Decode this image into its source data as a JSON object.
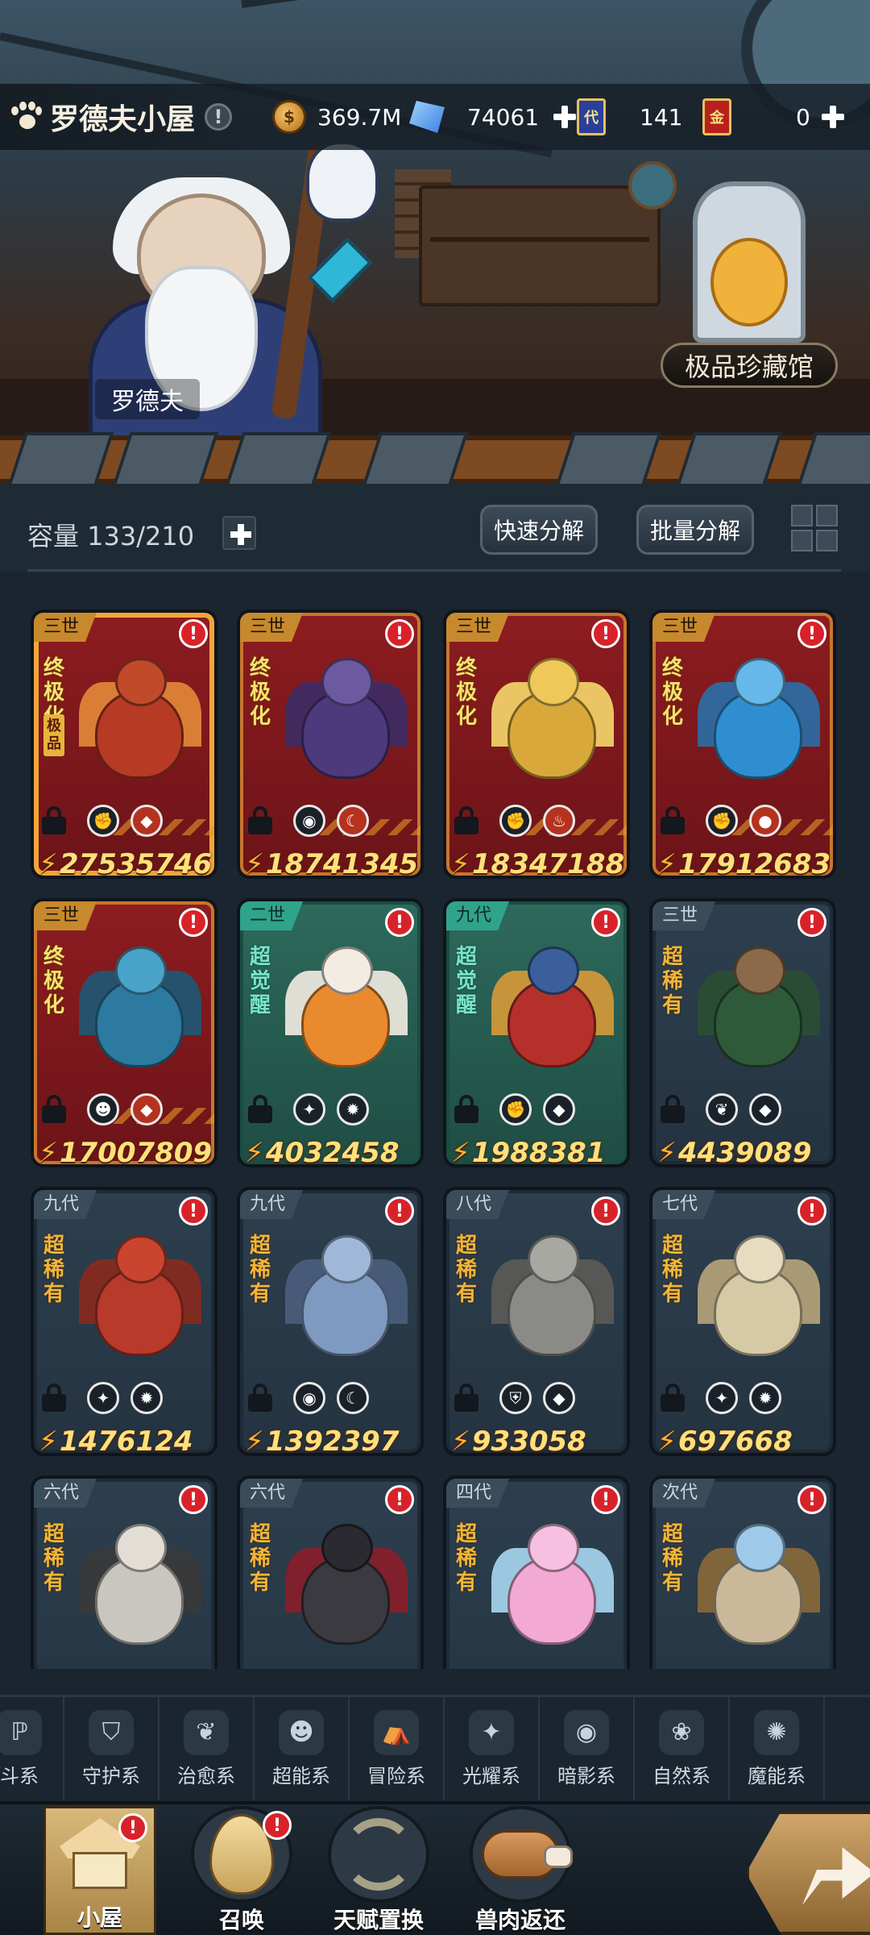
{
  "topbar": {
    "home_title": "罗德夫小屋",
    "info_icon_glyph": "!",
    "gold": "369.7M",
    "crystal": "74061",
    "ticket_glyph": "代",
    "ticket_count": "141",
    "gold_card_glyph": "金",
    "gold_card_count": "0",
    "coin_glyph": "$"
  },
  "scene": {
    "npc_name": "罗德夫",
    "collection_label": "极品珍藏馆"
  },
  "toolbar": {
    "capacity_label": "容量 133/210",
    "quick_decompose": "快速分解",
    "batch_decompose": "批量分解"
  },
  "cards": [
    {
      "gen": "三世",
      "rank": "终极化",
      "extra": "极品",
      "power": "27535746",
      "style": "red",
      "selected": true,
      "elements": [
        "gauntlet",
        "rock"
      ],
      "body_color": "#b63a24",
      "head_color": "#c14a2a",
      "wing_color": "#e38a3a"
    },
    {
      "gen": "三世",
      "rank": "终极化",
      "power": "18741345",
      "style": "red",
      "elements": [
        "eye",
        "moon"
      ],
      "body_color": "#4d3a7c",
      "head_color": "#6c5aa0",
      "wing_color": "#3b2c66"
    },
    {
      "gen": "三世",
      "rank": "终极化",
      "power": "18347188",
      "style": "red",
      "elements": [
        "gauntlet",
        "fire"
      ],
      "body_color": "#d8a93a",
      "head_color": "#f0c85a",
      "wing_color": "#f6d86b"
    },
    {
      "gen": "三世",
      "rank": "终极化",
      "power": "17912683",
      "style": "red",
      "elements": [
        "gauntlet",
        "water"
      ],
      "body_color": "#2f8ed0",
      "head_color": "#66b8ea",
      "wing_color": "#2a6fa8"
    },
    {
      "gen": "三世",
      "rank": "终极化",
      "power": "17007809",
      "style": "red",
      "elements": [
        "alien",
        "rock"
      ],
      "body_color": "#2d7aa0",
      "head_color": "#4aa3c8",
      "wing_color": "#1d5978"
    },
    {
      "gen": "二世",
      "rank": "超觉醒",
      "power": "4032458",
      "style": "green",
      "elements": [
        "star-cross",
        "sun"
      ],
      "body_color": "#e98a2e",
      "head_color": "#f3ece2",
      "wing_color": "#f3ece2"
    },
    {
      "gen": "九代",
      "rank": "超觉醒",
      "power": "1988381",
      "style": "green",
      "elements": [
        "gauntlet",
        "rock"
      ],
      "body_color": "#b5302a",
      "head_color": "#3a5f9a",
      "wing_color": "#d89a38"
    },
    {
      "gen": "三世",
      "rank": "超稀有",
      "power": "4439089",
      "style": "blue",
      "elements": [
        "leaf",
        "rock"
      ],
      "body_color": "#2f5a3a",
      "head_color": "#8a6a4a",
      "wing_color": "#2a4f33"
    },
    {
      "gen": "九代",
      "rank": "超稀有",
      "power": "1476124",
      "style": "blue",
      "elements": [
        "star-cross",
        "sun"
      ],
      "body_color": "#b73a2a",
      "head_color": "#c9452f",
      "wing_color": "#8a2a1e"
    },
    {
      "gen": "九代",
      "rank": "超稀有",
      "power": "1392397",
      "style": "blue",
      "elements": [
        "eye",
        "moon"
      ],
      "body_color": "#7e9ac0",
      "head_color": "#9fb8d8",
      "wing_color": "#4a5f7e"
    },
    {
      "gen": "八代",
      "rank": "超稀有",
      "power": "933058",
      "style": "blue",
      "elements": [
        "shield",
        "rock"
      ],
      "body_color": "#8a8a86",
      "head_color": "#a8a8a3",
      "wing_color": "#5c5c58"
    },
    {
      "gen": "七代",
      "rank": "超稀有",
      "power": "697668",
      "style": "blue",
      "elements": [
        "star-cross",
        "sun"
      ],
      "body_color": "#d6c9a5",
      "head_color": "#e6dcbf",
      "wing_color": "#b7a57a"
    },
    {
      "gen": "六代",
      "rank": "超稀有",
      "power": "",
      "style": "blue",
      "elements": [],
      "body_color": "#c9c6c0",
      "head_color": "#e2ded6",
      "wing_color": "#3a3a3a"
    },
    {
      "gen": "六代",
      "rank": "超稀有",
      "power": "",
      "style": "blue",
      "elements": [],
      "body_color": "#3a3a40",
      "head_color": "#2a2a30",
      "wing_color": "#8a1e2a"
    },
    {
      "gen": "四代",
      "rank": "超稀有",
      "power": "",
      "style": "blue",
      "elements": [],
      "body_color": "#f2a9d4",
      "head_color": "#f7c0e0",
      "wing_color": "#a7d7f2"
    },
    {
      "gen": "次代",
      "rank": "超稀有",
      "power": "",
      "style": "blue",
      "elements": [],
      "body_color": "#c9b89a",
      "head_color": "#9fc9e8",
      "wing_color": "#8a6a3a"
    }
  ],
  "element_glyphs": {
    "gauntlet": "✊",
    "rock": "◆",
    "eye": "◉",
    "moon": "☾",
    "fire": "♨",
    "water": "●",
    "alien": "☻",
    "star-cross": "✦",
    "sun": "✹",
    "leaf": "❦",
    "shield": "⛨"
  },
  "alert_glyph": "!",
  "categories": [
    {
      "label": "斗系",
      "glyph": "ℙ",
      "name": "fighting-category"
    },
    {
      "label": "守护系",
      "glyph": "⛉",
      "name": "guardian-category"
    },
    {
      "label": "治愈系",
      "glyph": "❦",
      "name": "healing-category"
    },
    {
      "label": "超能系",
      "glyph": "☻",
      "name": "psychic-category"
    },
    {
      "label": "冒险系",
      "glyph": "⛺",
      "name": "adventure-category"
    },
    {
      "label": "光耀系",
      "glyph": "✦",
      "name": "light-category"
    },
    {
      "label": "暗影系",
      "glyph": "◉",
      "name": "shadow-category"
    },
    {
      "label": "自然系",
      "glyph": "❀",
      "name": "nature-category"
    },
    {
      "label": "魔能系",
      "glyph": "✺",
      "name": "magic-category"
    }
  ],
  "nav": {
    "house": "小屋",
    "summon": "召唤",
    "talent": "天赋置换",
    "meat": "兽肉返还",
    "house_badge": "!",
    "summon_badge": "!"
  }
}
